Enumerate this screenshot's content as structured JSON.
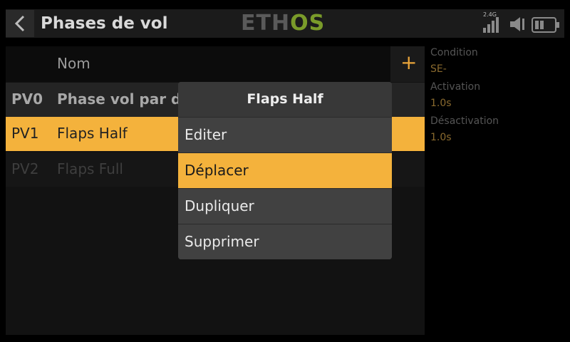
{
  "header": {
    "title": "Phases de vol",
    "logo_left": "ETH",
    "logo_right": "OS",
    "signal_label": "2.4G"
  },
  "list": {
    "column_name": "Nom",
    "add_label": "+",
    "rows": [
      {
        "id": "PV0",
        "name": "Phase vol par défaut"
      },
      {
        "id": "PV1",
        "name": "Flaps Half"
      },
      {
        "id": "PV2",
        "name": "Flaps Full"
      }
    ]
  },
  "panel": {
    "condition_label": "Condition",
    "condition_value": "SE-",
    "activation_label": "Activation",
    "activation_value": "1.0s",
    "deactivation_label": "Désactivation",
    "deactivation_value": "1.0s"
  },
  "popup": {
    "title": "Flaps Half",
    "items": [
      "Editer",
      "Déplacer",
      "Dupliquer",
      "Supprimer"
    ],
    "selected": "Déplacer"
  },
  "colors": {
    "accent": "#f4b23c",
    "logo_os": "#7a9b2a"
  },
  "icons": [
    "back-arrow-icon",
    "signal-bars-icon",
    "speaker-icon",
    "battery-icon",
    "plus-icon"
  ]
}
